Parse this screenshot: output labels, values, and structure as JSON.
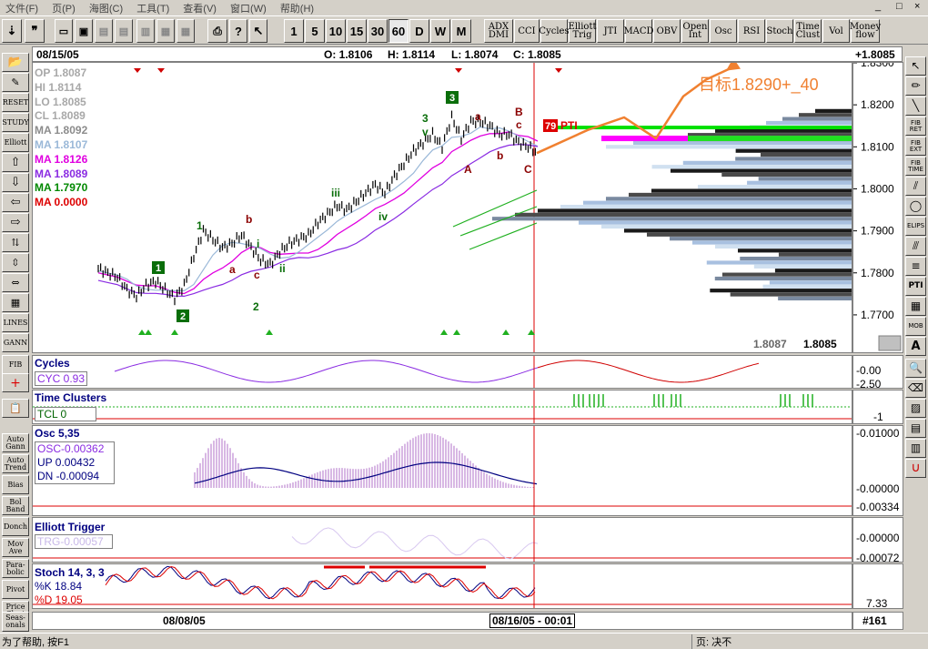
{
  "menu": {
    "items": [
      "文件(F)",
      "页(P)",
      "海图(C)",
      "工具(T)",
      "查看(V)",
      "窗口(W)",
      "帮助(H)"
    ],
    "window_controls": [
      "_",
      "□",
      "×"
    ]
  },
  "toolbar": {
    "intervals": [
      "1",
      "5",
      "10",
      "15",
      "30",
      "60",
      "D",
      "W",
      "M"
    ],
    "active_interval": "60",
    "indicators": [
      "ADX DMI",
      "CCI",
      "Cycles",
      "Elliott Trig",
      "JTI",
      "MACD",
      "OBV",
      "Open Int",
      "Osc",
      "RSI",
      "Stoch",
      "Time Clust",
      "Vol",
      "Money flow"
    ]
  },
  "left_tools": [
    "",
    "",
    "RESET",
    "STUDY",
    "Elliott",
    "",
    "",
    "",
    "",
    "",
    "",
    "",
    "LINES",
    "GANN",
    "FIB",
    "",
    "",
    "Auto Gann",
    "Auto Trend",
    "Bias",
    "Bol Band",
    "Donch",
    "Mov Ave",
    "Para-bolic",
    "Pivot",
    "Price Clust",
    "Seas-onals"
  ],
  "right_tools": [
    "",
    "",
    "FIB RET",
    "FIB EXT",
    "FIB TIME",
    "",
    "ELIPS",
    "",
    "PTI",
    "",
    "MOB",
    "A",
    "",
    "",
    "",
    "",
    "",
    ""
  ],
  "header": {
    "date": "08/15/05",
    "open": "O: 1.8106",
    "high": "H: 1.8114",
    "low": "L: 1.8074",
    "close": "C: 1.8085",
    "last": "+1.8085"
  },
  "price_legend": [
    {
      "label": "OP",
      "value": "1.8087",
      "color": "#a8a8a8"
    },
    {
      "label": "HI",
      "value": "1.8114",
      "color": "#a8a8a8"
    },
    {
      "label": "LO",
      "value": "1.8085",
      "color": "#a8a8a8"
    },
    {
      "label": "CL",
      "value": "1.8089",
      "color": "#a8a8a8"
    },
    {
      "label": "MA",
      "value": "1.8092",
      "color": "#8c8c8c"
    },
    {
      "label": "MA",
      "value": "1.8107",
      "color": "#9ab8d8"
    },
    {
      "label": "MA",
      "value": "1.8126",
      "color": "#e000e0"
    },
    {
      "label": "MA",
      "value": "1.8089",
      "color": "#8a2be2"
    },
    {
      "label": "MA",
      "value": "1.7970",
      "color": "#008800"
    },
    {
      "label": "MA",
      "value": "0.0000",
      "color": "#dd0000"
    }
  ],
  "annotation": {
    "target_text": "目标1.8290+_40",
    "pti_value": "79",
    "pti_label": "PTI"
  },
  "bottom_readout": {
    "left": "1.8087",
    "right": "1.8085"
  },
  "panels": {
    "cycles": {
      "title": "Cycles",
      "value_label": "CYC 0.93",
      "scale": [
        "-0.00",
        "-2.50"
      ]
    },
    "time_clusters": {
      "title": "Time Clusters",
      "value_label": "TCL 0",
      "scale": [
        "-1"
      ]
    },
    "osc": {
      "title": "Osc 5,35",
      "lines": [
        "OSC-0.00362",
        "UP   0.00432",
        "DN   -0.00094"
      ],
      "scale": [
        "-0.01000",
        "-0.00000",
        "-0.00334"
      ]
    },
    "elliott_trigger": {
      "title": "Elliott Trigger",
      "value_label": "TRG-0.00057",
      "scale": [
        "-0.00000",
        "-0.00072"
      ]
    },
    "stoch": {
      "title": "Stoch 14, 3, 3",
      "lines": [
        "%K   18.84",
        "%D   19.05"
      ],
      "scale": [
        "7.33"
      ]
    }
  },
  "time_axis": {
    "left_date": "08/08/05",
    "cursor_date": "08/16/05 - 00:01",
    "bar_count": "#161"
  },
  "status": {
    "left": "为了帮助, 按F1",
    "right": "页: 决不"
  },
  "chart_data": {
    "type": "line",
    "title": "",
    "xlabel": "",
    "ylabel": "",
    "ylim": [
      1.765,
      1.83
    ],
    "y_ticks": [
      "1.8300",
      "1.8200",
      "1.8100",
      "1.8000",
      "1.7900",
      "1.7800",
      "1.7700"
    ],
    "series": [
      {
        "name": "",
        "values": [
          1.781,
          1.78,
          1.779,
          1.776,
          1.7745,
          1.777,
          1.778,
          1.776,
          1.774,
          1.777,
          1.784,
          1.79,
          1.788,
          1.786,
          1.787,
          1.789,
          1.786,
          1.783,
          1.782,
          1.785,
          1.787,
          1.788,
          1.789,
          1.792,
          1.794,
          1.796,
          1.795,
          1.797,
          1.799,
          1.801,
          1.799,
          1.803,
          1.806,
          1.809,
          1.811,
          1.813,
          1.81,
          1.817,
          1.812,
          1.816,
          1.816,
          1.815,
          1.813,
          1.813,
          1.811,
          1.81,
          1.8085
        ]
      }
    ],
    "wave_labels": [
      "1",
      "2",
      "3",
      "a",
      "b",
      "c",
      "i",
      "ii",
      "iii",
      "iv",
      "v",
      "A",
      "B",
      "C"
    ],
    "projection": {
      "name": "",
      "values": [
        1.8085,
        1.814,
        1.817,
        1.812,
        1.822,
        1.826,
        1.829
      ]
    }
  }
}
